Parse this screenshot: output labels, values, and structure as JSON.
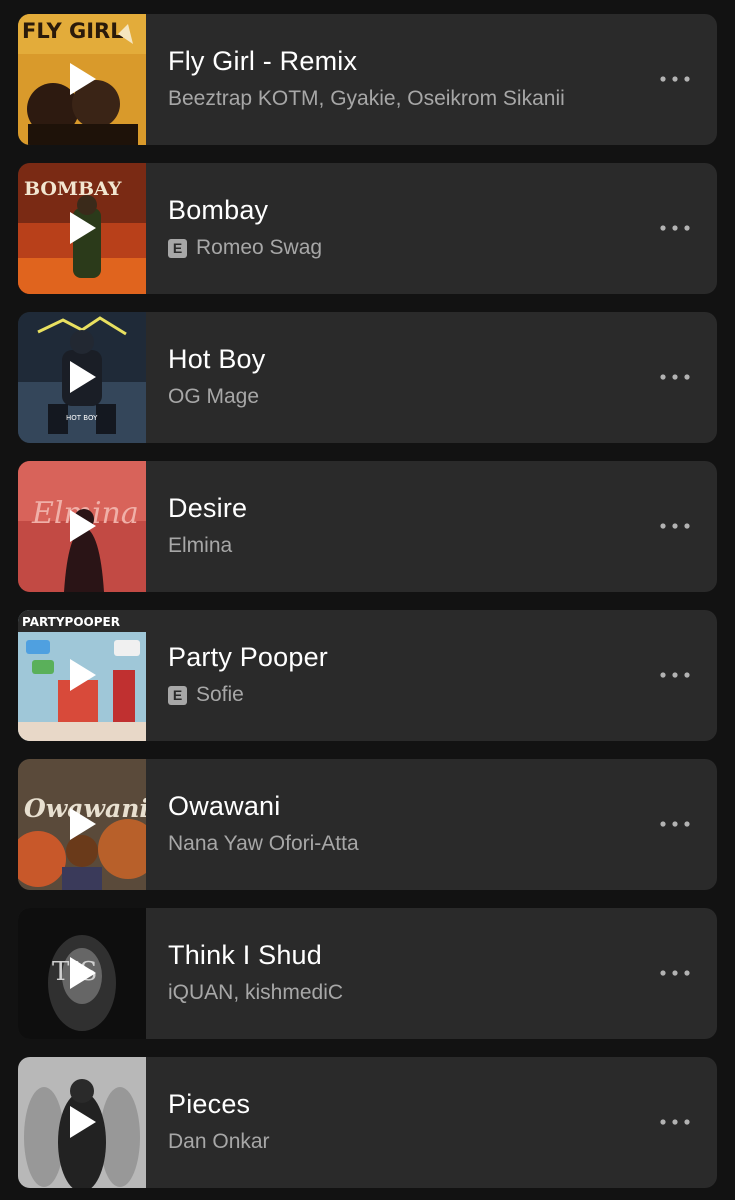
{
  "tracks": [
    {
      "title": "Fly Girl - Remix",
      "artists": "Beeztrap KOTM, Gyakie, Oseikrom Sikanii",
      "explicit": false,
      "cover_text": "FLY GIRL"
    },
    {
      "title": "Bombay",
      "artists": "Romeo Swag",
      "explicit": true,
      "explicit_label": "E",
      "cover_text": "BOMBAY"
    },
    {
      "title": "Hot Boy",
      "artists": "OG Mage",
      "explicit": false,
      "cover_text": "HOT BOY"
    },
    {
      "title": "Desire",
      "artists": "Elmina",
      "explicit": false,
      "cover_text": "Elmina"
    },
    {
      "title": "Party Pooper",
      "artists": "Sofie",
      "explicit": true,
      "explicit_label": "E",
      "cover_text": "PARTYPOOPER"
    },
    {
      "title": "Owawani",
      "artists": "Nana Yaw Ofori-Atta",
      "explicit": false,
      "cover_text": "Owawani"
    },
    {
      "title": "Think I Shud",
      "artists": "iQUAN, kishmediC",
      "explicit": false,
      "cover_text": "TIS"
    },
    {
      "title": "Pieces",
      "artists": "Dan Onkar",
      "explicit": false
    }
  ],
  "colors": {
    "background": "#121212",
    "row": "#2a2a2a",
    "title": "#ffffff",
    "subtitle": "#a7a7a7"
  },
  "icons": {
    "play": "play-icon",
    "more": "more-options-icon",
    "explicit": "explicit-badge"
  }
}
